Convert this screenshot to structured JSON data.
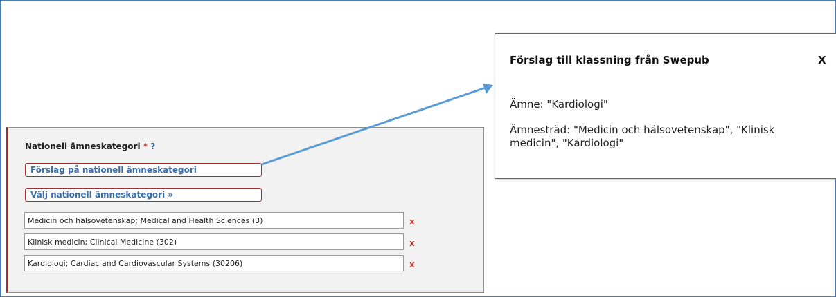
{
  "form": {
    "heading": "Nationell ämneskategori",
    "required_marker": "*",
    "help_marker": "?",
    "suggest_button": "Förslag på nationell ämneskategori",
    "choose_button": "Välj nationell ämneskategori »",
    "remove_symbol": "x",
    "categories": [
      "Medicin och hälsovetenskap; Medical and Health Sciences (3)",
      "Klinisk medicin; Clinical Medicine (302)",
      "Kardiologi; Cardiac and Cardiovascular Systems (30206)"
    ]
  },
  "popup": {
    "title": "Förslag till klassning från Swepub",
    "close": "X",
    "subject_line": "Ämne: \"Kardiologi\"",
    "tree_line": "Ämnesträd: \"Medicin och hälsovetenskap\", \"Klinisk medicin\", \"Kardiologi\""
  },
  "colors": {
    "arrow": "#5b9bd5",
    "frame_border": "#4a7ebb",
    "required_red": "#c0392b",
    "link_blue": "#3a6ea8"
  }
}
